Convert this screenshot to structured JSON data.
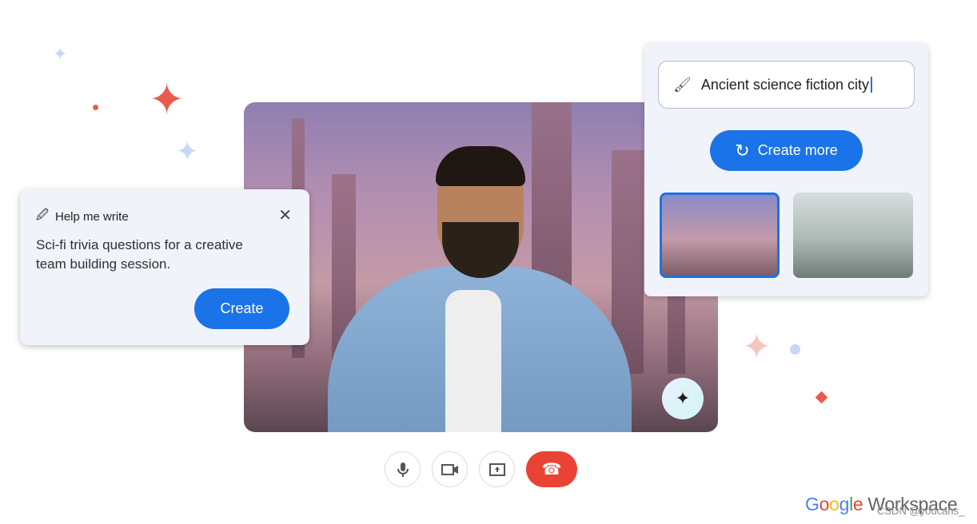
{
  "help_card": {
    "title": "Help me write",
    "text": "Sci-fi trivia questions for a creative team building session.",
    "button": "Create"
  },
  "generator": {
    "prompt_value": "Ancient science fiction city",
    "button": "Create more"
  },
  "controls": {
    "mic": "microphone-icon",
    "camera": "camera-icon",
    "present": "present-screen-icon",
    "end": "hang-up-icon"
  },
  "brand": {
    "google": "Google",
    "product": "Workspace",
    "watermark": "CSDN @youcans_"
  },
  "colors": {
    "accent": "#1a73e8",
    "end_call": "#ea4335"
  }
}
